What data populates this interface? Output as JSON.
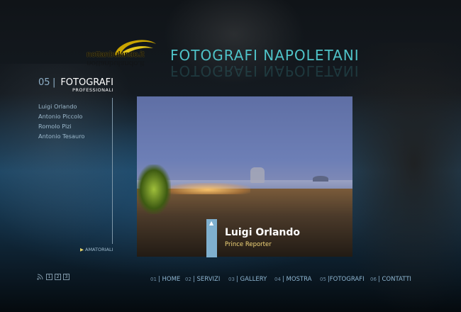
{
  "brand": {
    "logo_text": "nottanbulando.it",
    "site_title": "FOTOGRAFI NAPOLETANI"
  },
  "section": {
    "number": "05",
    "separator": "|",
    "name": "FOTOGRAFI",
    "subtitle": "PROFESSIONALI"
  },
  "photographers": [
    {
      "label": "Luigi Orlando"
    },
    {
      "label": "Antonio Piccolo"
    },
    {
      "label": "Romolo Pizi"
    },
    {
      "label": "Antonio Tesauro"
    }
  ],
  "amatoriali": {
    "arrow": "▶",
    "label": "AMATORIALI"
  },
  "caption": {
    "up_arrow": "▲",
    "name": "Luigi Orlando",
    "subtitle": "Prince Reporter"
  },
  "nav": [
    {
      "num": "01",
      "label": "| HOME"
    },
    {
      "num": "02",
      "label": "| SERVIZI"
    },
    {
      "num": "03",
      "label": "| GALLERY"
    },
    {
      "num": "04",
      "label": "| MOSTRA"
    },
    {
      "num": "05",
      "label": "|FOTOGRAFI"
    },
    {
      "num": "06",
      "label": "| CONTATTI"
    }
  ],
  "mini_pages": [
    "1",
    "2",
    "3"
  ],
  "icons": {
    "rss": "rss-icon"
  },
  "colors": {
    "accent_title": "#4fc3c8",
    "link": "#9db9cc",
    "caption_sub": "#f3d77a",
    "caption_tab": "#7fb0cf"
  }
}
